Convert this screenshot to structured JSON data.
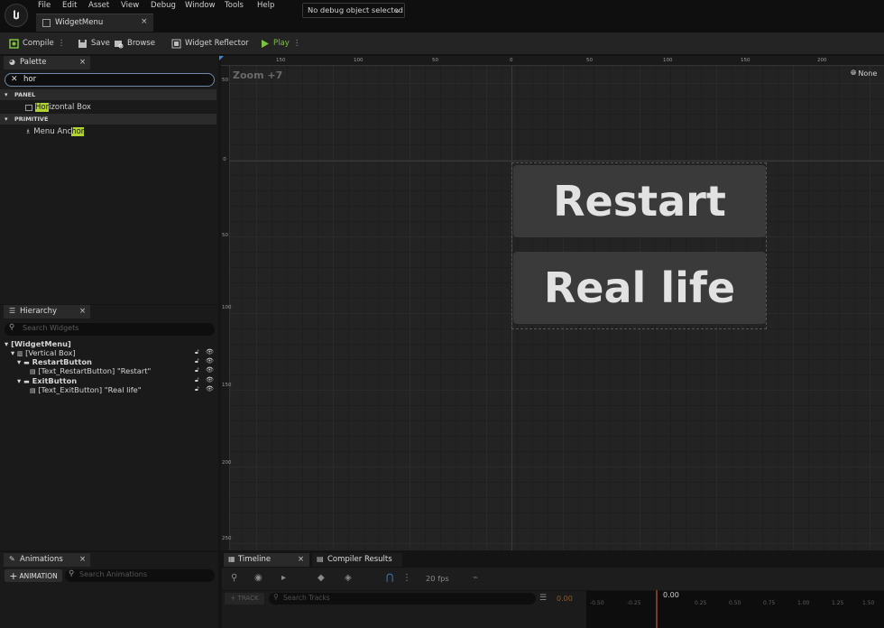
{
  "menu": [
    "File",
    "Edit",
    "Asset",
    "View",
    "Debug",
    "Window",
    "Tools",
    "Help"
  ],
  "document_tab": {
    "label": "WidgetMenu",
    "close": "×"
  },
  "toolbar": {
    "compile": "Compile",
    "save": "Save",
    "browse": "Browse",
    "widget_reflector": "Widget Reflector",
    "play": "Play",
    "debug_object": "No debug object selected"
  },
  "palette": {
    "tab": "Palette",
    "search_value": "hor",
    "categories": [
      {
        "name": "PANEL",
        "items": [
          {
            "match": "Hor",
            "rest": "izontal Box"
          }
        ]
      },
      {
        "name": "PRIMITIVE",
        "items": [
          {
            "prefix": "Menu Anc",
            "match": "hor"
          }
        ]
      }
    ]
  },
  "hierarchy": {
    "tab": "Hierarchy",
    "search_placeholder": "Search Widgets",
    "nodes": [
      {
        "label": "[WidgetMenu]"
      },
      {
        "label": "[Vertical Box]"
      },
      {
        "label": "RestartButton"
      },
      {
        "label": "[Text_RestartButton] \"Restart\""
      },
      {
        "label": "ExitButton"
      },
      {
        "label": "[Text_ExitButton] \"Real life\""
      }
    ]
  },
  "viewport": {
    "zoom": "Zoom +7",
    "none_button": "None",
    "ruler_top": [
      "150",
      "100",
      "50",
      "0",
      "50",
      "100",
      "150",
      "200"
    ],
    "ruler_left": [
      "50",
      "0",
      "50",
      "100",
      "150",
      "200",
      "250"
    ],
    "buttons": [
      "Restart",
      "Real life"
    ]
  },
  "animations": {
    "tab": "Animations",
    "add_label": "ANIMATION",
    "search_placeholder": "Search Animations"
  },
  "timeline": {
    "tab": "Timeline",
    "compiler_tab": "Compiler Results",
    "fps": "20 fps",
    "track_btn": "TRACK",
    "search_tracks": "Search Tracks",
    "time_left": "0.00",
    "time_head": "0.00",
    "ticks": [
      "-0.50",
      "-0.25",
      "0.25",
      "0.50",
      "0.75",
      "1.00",
      "1.25",
      "1.50"
    ]
  },
  "colors": {
    "highlight": "#b2d233",
    "play_green": "#7fc242",
    "accent_blue": "#3d86d8"
  }
}
